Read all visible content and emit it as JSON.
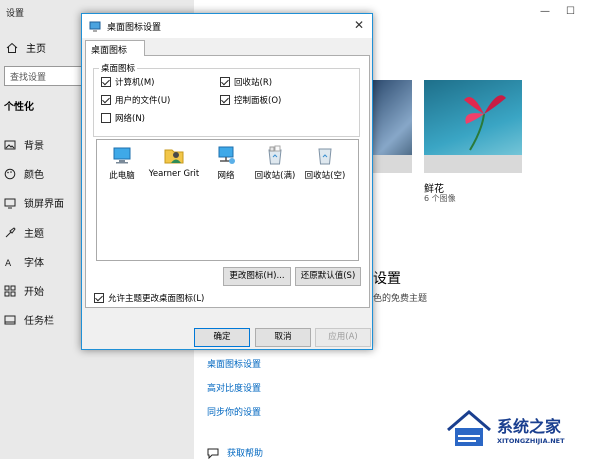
{
  "settings": {
    "title": "设置",
    "home": "主页",
    "search_placeholder": "查找设置",
    "section": "个性化",
    "nav": [
      "背景",
      "颜色",
      "锁屏界面",
      "主题",
      "字体",
      "开始",
      "任务栏"
    ],
    "theme_name": "鲜花",
    "theme_count": "6 个图像",
    "heading": "设置",
    "subtitle": "色的免费主题",
    "links": [
      "桌面图标设置",
      "高对比度设置",
      "同步你的设置"
    ],
    "help": "获取帮助"
  },
  "dialog": {
    "title": "桌面图标设置",
    "tab": "桌面图标",
    "group_label": "桌面图标",
    "checkboxes": [
      {
        "label": "计算机(M)",
        "checked": true
      },
      {
        "label": "回收站(R)",
        "checked": true
      },
      {
        "label": "用户的文件(U)",
        "checked": true
      },
      {
        "label": "控制面板(O)",
        "checked": true
      },
      {
        "label": "网络(N)",
        "checked": false
      }
    ],
    "icons": [
      "此电脑",
      "Yearner Grit",
      "网络",
      "回收站(满)",
      "回收站(空)"
    ],
    "change_icon": "更改图标(H)...",
    "restore_default": "还原默认值(S)",
    "allow_themes": {
      "label": "允许主题更改桌面图标(L)",
      "checked": true
    },
    "ok": "确定",
    "cancel": "取消",
    "apply": "应用(A)"
  },
  "watermark": {
    "name": "系统之家",
    "url": "XITONGZHIJIA.NET"
  }
}
